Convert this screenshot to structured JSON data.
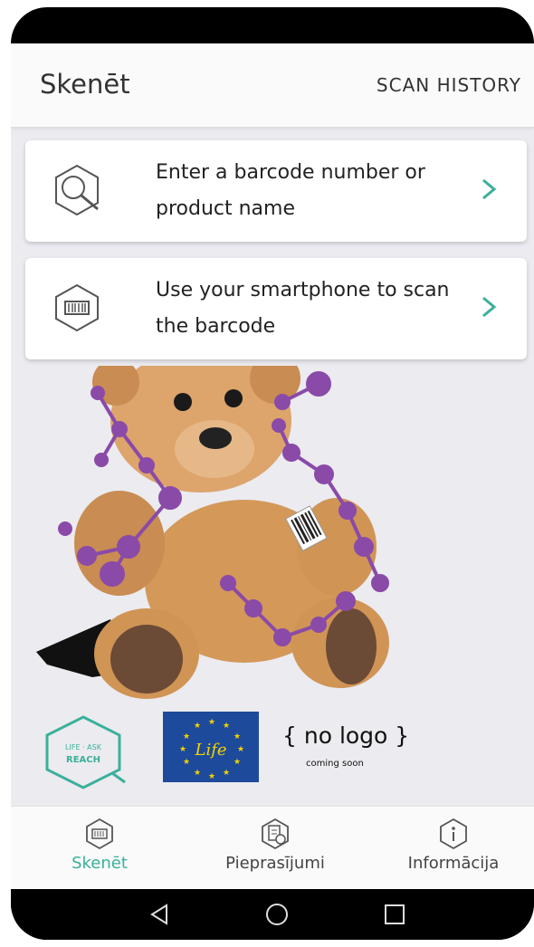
{
  "app": {
    "title": "Skenēt",
    "scan_history_label": "SCAN HISTORY"
  },
  "actions": [
    {
      "label": "Enter a barcode number or product name",
      "icon": "magnifier-hexagon-icon"
    },
    {
      "label": "Use your smartphone to scan the barcode",
      "icon": "barcode-scan-icon"
    }
  ],
  "logos": {
    "reach_top": "LIFE · ASK",
    "reach_name": "REACH",
    "eu_life_text": "Life",
    "no_logo_text": "{ no logo }",
    "coming_soon": "coming soon"
  },
  "tabs": [
    {
      "label": "Skenēt",
      "icon": "barcode-scan-icon",
      "active": true
    },
    {
      "label": "Pieprasījumi",
      "icon": "document-clock-icon",
      "active": false
    },
    {
      "label": "Informācija",
      "icon": "info-icon",
      "active": false
    }
  ],
  "colors": {
    "accent": "#3bb09a",
    "molecule": "#8a4aa8",
    "teddy": "#d9a066",
    "eu_blue": "#1d4a9b",
    "eu_star": "#f5d300"
  }
}
